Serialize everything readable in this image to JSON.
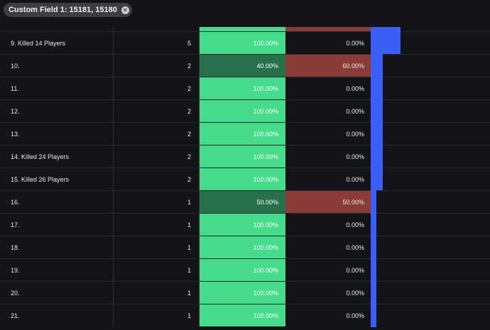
{
  "filter_chip": {
    "label": "Custom Field 1: 15181, 15180",
    "close_icon": "close-circle-icon"
  },
  "colors": {
    "positive_full": "#45db8b",
    "positive_partial": "#26704a",
    "negative": "#8c3c38",
    "bar": "#3b5ef5"
  },
  "rows": [
    {
      "name": "",
      "count": "",
      "pos": "",
      "neg": "",
      "pos_fraction": 1.0,
      "bar_fraction": 0.25
    },
    {
      "name": "9. Killed 14 Players",
      "count": "5",
      "pos": "100.00%",
      "neg": "0.00%",
      "pos_fraction": 1.0,
      "bar_fraction": 0.25
    },
    {
      "name": "10.",
      "count": "2",
      "pos": "40.00%",
      "neg": "60.00%",
      "pos_fraction": 0.4,
      "bar_fraction": 0.1
    },
    {
      "name": "11.",
      "count": "2",
      "pos": "100.00%",
      "neg": "0.00%",
      "pos_fraction": 1.0,
      "bar_fraction": 0.1
    },
    {
      "name": "12.",
      "count": "2",
      "pos": "100.00%",
      "neg": "0.00%",
      "pos_fraction": 1.0,
      "bar_fraction": 0.1
    },
    {
      "name": "13.",
      "count": "2",
      "pos": "100.00%",
      "neg": "0.00%",
      "pos_fraction": 1.0,
      "bar_fraction": 0.1
    },
    {
      "name": "14. Killed 24 Players",
      "count": "2",
      "pos": "100.00%",
      "neg": "0.00%",
      "pos_fraction": 1.0,
      "bar_fraction": 0.1
    },
    {
      "name": "15. Killed 26 Players",
      "count": "2",
      "pos": "100.00%",
      "neg": "0.00%",
      "pos_fraction": 1.0,
      "bar_fraction": 0.1
    },
    {
      "name": "16.",
      "count": "1",
      "pos": "50.00%",
      "neg": "50.00%",
      "pos_fraction": 0.5,
      "bar_fraction": 0.05
    },
    {
      "name": "17.",
      "count": "1",
      "pos": "100.00%",
      "neg": "0.00%",
      "pos_fraction": 1.0,
      "bar_fraction": 0.05
    },
    {
      "name": "18.",
      "count": "1",
      "pos": "100.00%",
      "neg": "0.00%",
      "pos_fraction": 1.0,
      "bar_fraction": 0.05
    },
    {
      "name": "19.",
      "count": "1",
      "pos": "100.00%",
      "neg": "0.00%",
      "pos_fraction": 1.0,
      "bar_fraction": 0.05
    },
    {
      "name": "20.",
      "count": "1",
      "pos": "100.00%",
      "neg": "0.00%",
      "pos_fraction": 1.0,
      "bar_fraction": 0.05
    },
    {
      "name": "21.",
      "count": "1",
      "pos": "100.00%",
      "neg": "0.00%",
      "pos_fraction": 1.0,
      "bar_fraction": 0.05
    }
  ]
}
